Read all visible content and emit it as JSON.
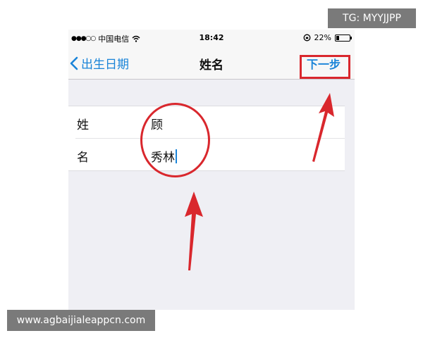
{
  "status_bar": {
    "signal": "●●●○○",
    "carrier": "中国电信",
    "time": "18:42",
    "battery": "22%"
  },
  "nav": {
    "back_label": "出生日期",
    "title": "姓名",
    "next_label": "下一步"
  },
  "form": {
    "rows": [
      {
        "label": "姓",
        "value": "顾"
      },
      {
        "label": "名",
        "value": "秀林"
      }
    ]
  },
  "overlays": {
    "top_tag": "TG: MYYJJPP",
    "bottom_tag": "www.agbaijialeappcn.com",
    "annotation_color": "#d9272d"
  },
  "colors": {
    "accent": "#1a84d8"
  }
}
